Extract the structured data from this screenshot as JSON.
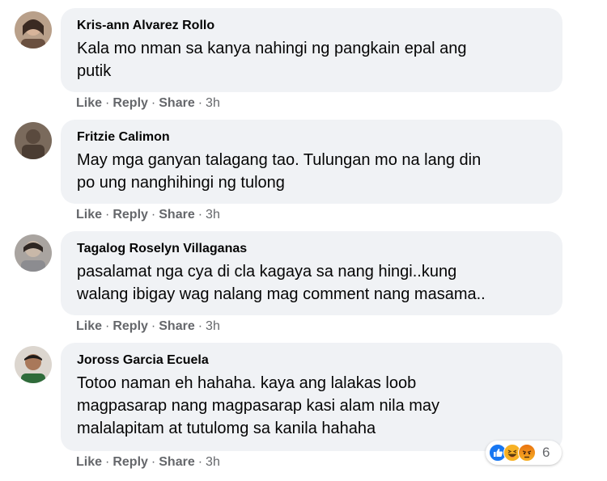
{
  "comments": [
    {
      "author": "Kris-ann Alvarez Rollo",
      "text_lines": [
        "Kala mo nman sa kanya nahingi ng pangkain epal ang",
        "putik"
      ],
      "actions": {
        "like": "Like",
        "reply": "Reply",
        "share": "Share",
        "time": "3h"
      }
    },
    {
      "author": "Fritzie Calimon",
      "text_lines": [
        "May mga ganyan talagang tao. Tulungan mo na lang din",
        "po ung nanghihingi ng tulong"
      ],
      "actions": {
        "like": "Like",
        "reply": "Reply",
        "share": "Share",
        "time": "3h"
      }
    },
    {
      "author": "Tagalog Roselyn Villaganas",
      "text_lines": [
        "pasalamat nga cya di cla kagaya sa nang hingi..kung",
        "walang ibigay wag nalang mag comment nang masama.."
      ],
      "actions": {
        "like": "Like",
        "reply": "Reply",
        "share": "Share",
        "time": "3h"
      }
    },
    {
      "author": "Joross Garcia Ecuela",
      "text_lines": [
        "Totoo naman eh hahaha. kaya ang lalakas loob",
        "magpasarap nang magpasarap kasi alam nila may",
        "malalapitam at tutulomg sa kanila hahaha"
      ],
      "actions": {
        "like": "Like",
        "reply": "Reply",
        "share": "Share",
        "time": "3h"
      }
    }
  ],
  "reactions": {
    "icons": [
      "like-icon",
      "haha-icon",
      "angry-icon"
    ],
    "count": "6"
  },
  "colors": {
    "bubble": "#f0f2f5",
    "meta": "#65676b",
    "like_blue": "#1877f2",
    "haha_yellow": "#f7b125",
    "angry_orange": "#e9710f"
  }
}
